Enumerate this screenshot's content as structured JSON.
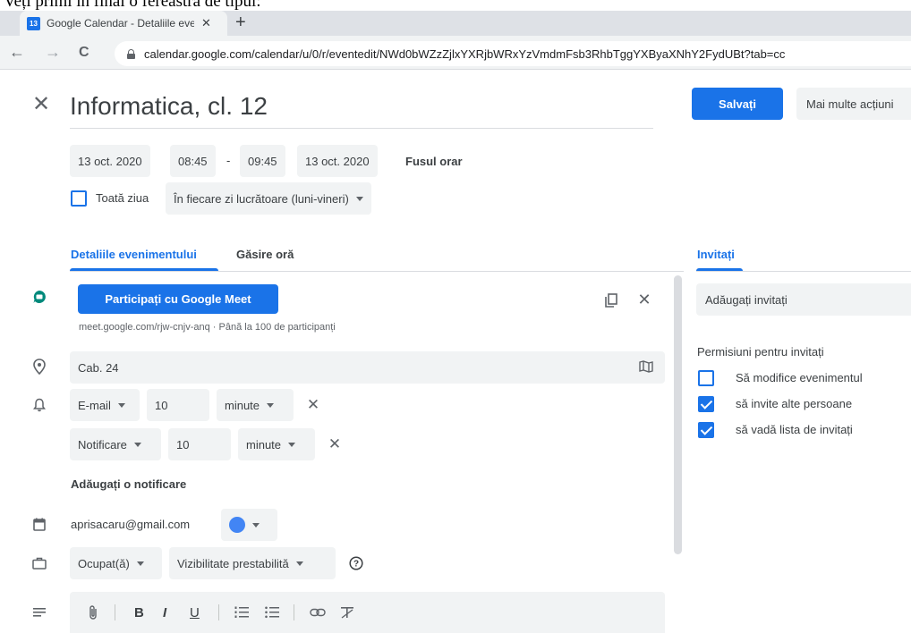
{
  "doc_caption": "Veți primi în final o fereastra de tipul:",
  "browser": {
    "tab_favicon": "13",
    "tab_title": "Google Calendar - Detaliile evenim",
    "tab_close": "✕",
    "new_tab": "+",
    "back": "←",
    "forward": "→",
    "reload": "C",
    "url": "calendar.google.com/calendar/u/0/r/eventedit/NWd0bWZzZjlxYXRjbWRxYzVmdmFsb3RhbTggYXByaXNhY2FydUBt?tab=cc"
  },
  "header": {
    "close": "✕",
    "title": "Informatica, cl. 12",
    "save": "Salvați",
    "more_actions": "Mai multe acțiuni"
  },
  "datetime": {
    "start_date": "13 oct. 2020",
    "start_time": "08:45",
    "separator": "-",
    "end_time": "09:45",
    "end_date": "13 oct. 2020",
    "timezone": "Fusul orar",
    "all_day_label": "Toată ziua",
    "all_day_checked": false,
    "recurrence": "În fiecare zi lucrătoare (luni-vineri)"
  },
  "tabs": {
    "details": "Detaliile evenimentului",
    "find_time": "Găsire oră",
    "guests": "Invitați"
  },
  "meet": {
    "join_button": "Participați cu Google Meet",
    "info": "meet.google.com/rjw-cnjv-anq · Până la 100 de participanți"
  },
  "location": {
    "value": "Cab. 24"
  },
  "notifications": [
    {
      "type": "E-mail",
      "amount": "10",
      "unit": "minute"
    },
    {
      "type": "Notificare",
      "amount": "10",
      "unit": "minute"
    }
  ],
  "add_notification": "Adăugați o notificare",
  "calendar": {
    "owner": "aprisacaru@gmail.com",
    "color": "#4285f4"
  },
  "availability": {
    "status": "Ocupat(ă)",
    "visibility": "Vizibilitate prestabilită"
  },
  "guests": {
    "add_placeholder": "Adăugați invitați",
    "permissions_title": "Permisiuni pentru invitați",
    "permissions": [
      {
        "label": "Să modifice evenimentul",
        "checked": false
      },
      {
        "label": "să invite alte persoane",
        "checked": true
      },
      {
        "label": "să vadă lista de invitați",
        "checked": true
      }
    ]
  },
  "colors": {
    "accent": "#1a73e8",
    "meet_green": "#00897b"
  }
}
